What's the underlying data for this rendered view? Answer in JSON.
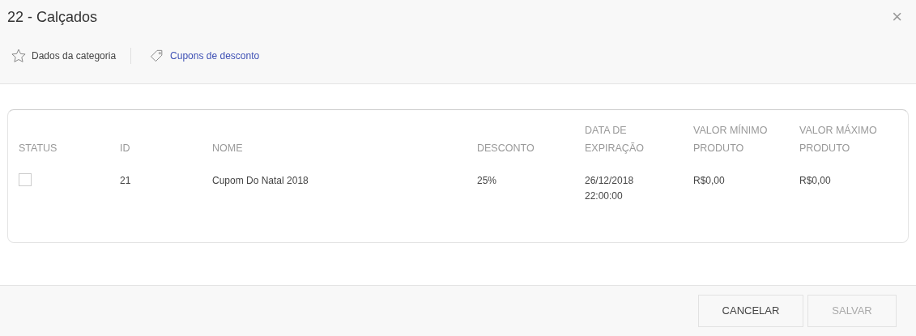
{
  "window": {
    "title": "22 - Calçados",
    "close": "×"
  },
  "tabs": [
    {
      "label": "Dados da categoria",
      "selected": false
    },
    {
      "label": "Cupons de desconto",
      "selected": true
    }
  ],
  "table": {
    "columns": [
      "STATUS",
      "ID",
      "NOME",
      "DESCONTO",
      "DATA DE EXPIRAÇÃO",
      "VALOR MÍNIMO PRODUTO",
      "VALOR MÁXIMO PRODUTO"
    ],
    "rows": [
      {
        "checked": false,
        "cells": [
          "",
          "21",
          "Cupom Do Natal 2018",
          "25%",
          "26/12/2018 22:00:00",
          "R$0,00",
          "R$0,00"
        ]
      }
    ]
  },
  "buttons": [
    {
      "label": "CANCELAR",
      "disabled": false
    },
    {
      "label": "SALVAR",
      "disabled": true
    }
  ]
}
